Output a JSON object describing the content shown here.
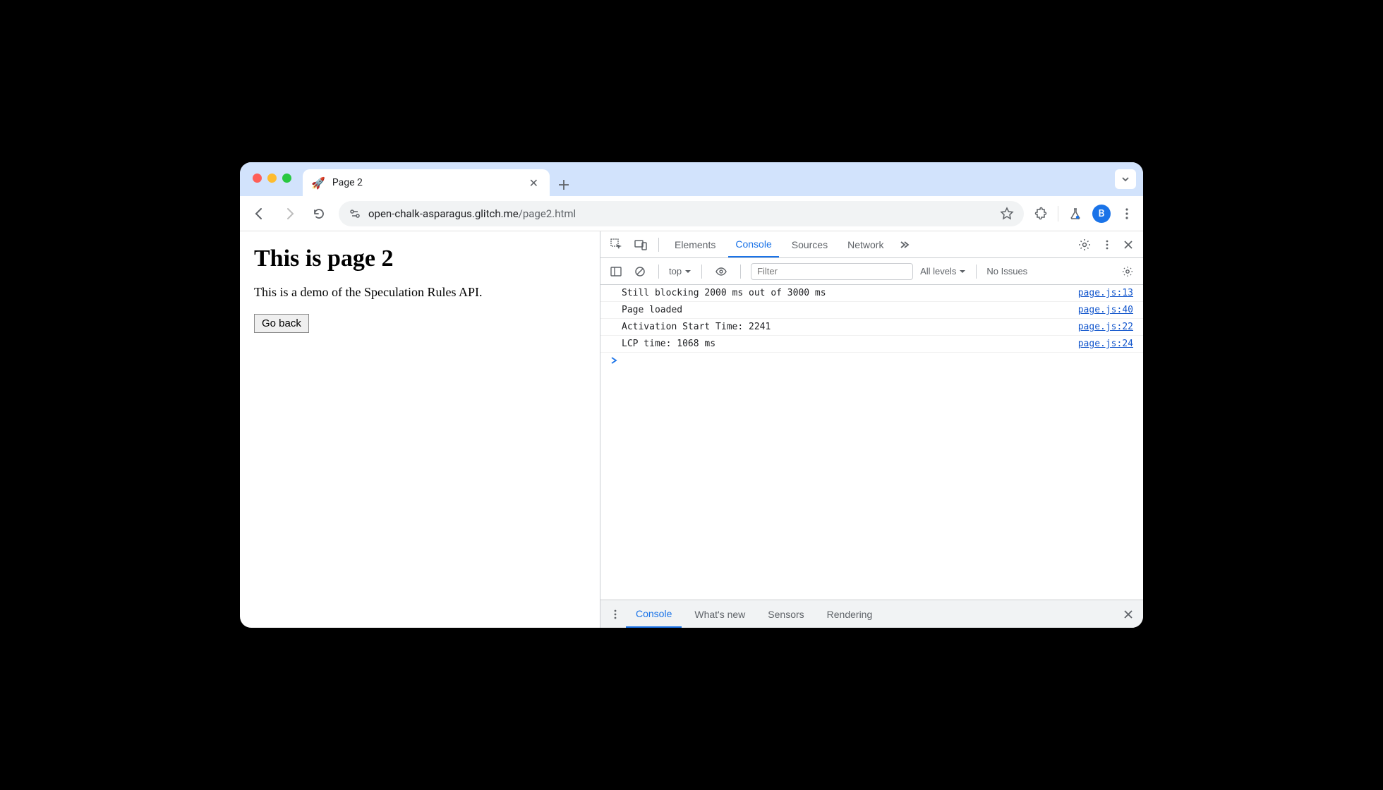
{
  "tab": {
    "favicon": "🚀",
    "title": "Page 2"
  },
  "url": {
    "host": "open-chalk-asparagus.glitch.me",
    "path": "/page2.html"
  },
  "avatar_letter": "B",
  "page": {
    "heading": "This is page 2",
    "subtext": "This is a demo of the Speculation Rules API.",
    "button": "Go back"
  },
  "devtools": {
    "tabs": [
      "Elements",
      "Console",
      "Sources",
      "Network"
    ],
    "active_tab": "Console",
    "context": "top",
    "filter_placeholder": "Filter",
    "levels": "All levels",
    "issues": "No Issues",
    "logs": [
      {
        "msg": "Still blocking 2000 ms out of 3000 ms",
        "src": "page.js:13"
      },
      {
        "msg": "Page loaded",
        "src": "page.js:40"
      },
      {
        "msg": "Activation Start Time: 2241",
        "src": "page.js:22"
      },
      {
        "msg": "LCP time: 1068 ms",
        "src": "page.js:24"
      }
    ],
    "drawer_tabs": [
      "Console",
      "What's new",
      "Sensors",
      "Rendering"
    ],
    "drawer_active": "Console"
  }
}
